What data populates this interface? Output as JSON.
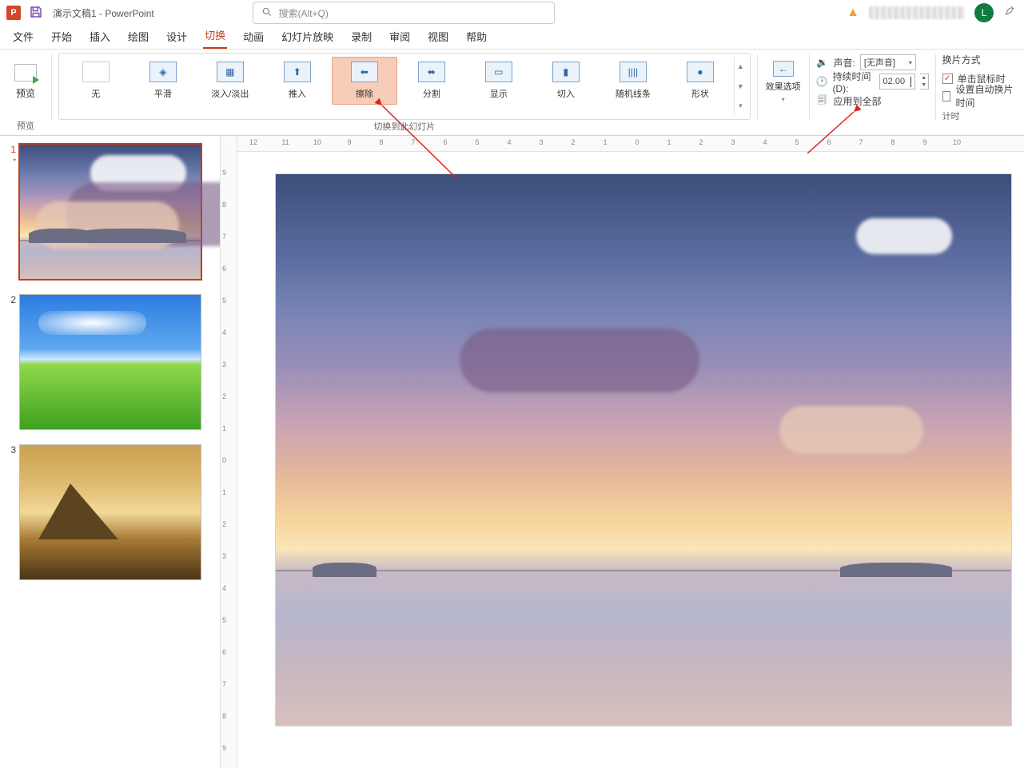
{
  "titlebar": {
    "app_letter": "P",
    "doc_title": "演示文稿1  -  PowerPoint",
    "search_placeholder": "搜索(Alt+Q)",
    "avatar_letter": "L"
  },
  "menu": {
    "tabs": [
      "文件",
      "开始",
      "插入",
      "绘图",
      "设计",
      "切换",
      "动画",
      "幻灯片放映",
      "录制",
      "审阅",
      "视图",
      "帮助"
    ],
    "active_index": 5
  },
  "ribbon": {
    "preview": {
      "label": "预览",
      "group_label": "预览"
    },
    "transitions": {
      "items": [
        {
          "label": "无",
          "icon": "none"
        },
        {
          "label": "平滑",
          "icon": "morph"
        },
        {
          "label": "淡入/淡出",
          "icon": "fade"
        },
        {
          "label": "推入",
          "icon": "push"
        },
        {
          "label": "擦除",
          "icon": "wipe"
        },
        {
          "label": "分割",
          "icon": "split"
        },
        {
          "label": "显示",
          "icon": "reveal"
        },
        {
          "label": "切入",
          "icon": "cut"
        },
        {
          "label": "随机线条",
          "icon": "random-bars"
        },
        {
          "label": "形状",
          "icon": "shape"
        }
      ],
      "selected_index": 4,
      "group_label": "切换到此幻灯片"
    },
    "effect_options": {
      "label": "效果选项"
    },
    "timing": {
      "sound_label": "声音:",
      "sound_value": "[无声音]",
      "duration_label": "持续时间(D):",
      "duration_value": "02.00",
      "apply_all": "应用到全部"
    },
    "advance": {
      "title": "换片方式",
      "on_click": "单击鼠标时",
      "on_click_checked": true,
      "auto_after": "设置自动换片时间",
      "auto_after_checked": false,
      "group_label": "计时"
    }
  },
  "thumbs": {
    "slides": [
      {
        "num": "1",
        "star": "*"
      },
      {
        "num": "2",
        "star": ""
      },
      {
        "num": "3",
        "star": ""
      }
    ],
    "selected_index": 0
  },
  "ruler": {
    "h_ticks": [
      "12",
      "11",
      "10",
      "9",
      "8",
      "7",
      "6",
      "5",
      "4",
      "3",
      "2",
      "1",
      "0",
      "1",
      "2",
      "3",
      "4",
      "5",
      "6",
      "7",
      "8",
      "9",
      "10"
    ],
    "v_ticks": [
      "9",
      "8",
      "7",
      "6",
      "5",
      "4",
      "3",
      "2",
      "1",
      "0",
      "1",
      "2",
      "3",
      "4",
      "5",
      "6",
      "7",
      "8",
      "9"
    ]
  }
}
